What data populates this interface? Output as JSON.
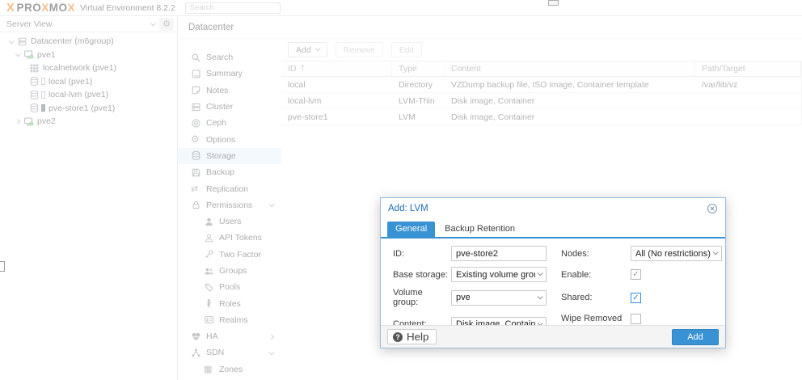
{
  "topbar": {
    "logo_mark": "X",
    "logo_parts": {
      "p1": "PRO",
      "x1": "X",
      "p2": "MO",
      "x2": "X"
    },
    "subtitle": "Virtual Environment 8.2.2",
    "search_placeholder": "Search"
  },
  "left_panel": {
    "view_selector": "Server View",
    "tree": [
      {
        "label": "Datacenter (m6group)",
        "icon": "datacenter"
      },
      {
        "label": "pve1",
        "icon": "node-online"
      },
      {
        "label": "localnetwork (pve1)",
        "icon": "network"
      },
      {
        "label": "local (pve1)",
        "icon": "storage"
      },
      {
        "label": "local-lvm (pve1)",
        "icon": "storage"
      },
      {
        "label": "pve-store1 (pve1)",
        "icon": "storage-active"
      },
      {
        "label": "pve2",
        "icon": "node-online"
      }
    ]
  },
  "panel": {
    "title": "Datacenter"
  },
  "menu": {
    "items": [
      {
        "label": "Search"
      },
      {
        "label": "Summary"
      },
      {
        "label": "Notes"
      },
      {
        "label": "Cluster"
      },
      {
        "label": "Ceph"
      },
      {
        "label": "Options"
      },
      {
        "label": "Storage",
        "selected": true
      },
      {
        "label": "Backup"
      },
      {
        "label": "Replication"
      },
      {
        "label": "Permissions",
        "expanded": true
      },
      {
        "label": "Users"
      },
      {
        "label": "API Tokens"
      },
      {
        "label": "Two Factor"
      },
      {
        "label": "Groups"
      },
      {
        "label": "Pools"
      },
      {
        "label": "Roles"
      },
      {
        "label": "Realms"
      },
      {
        "label": "HA",
        "expanded": false
      },
      {
        "label": "SDN",
        "expanded": true
      },
      {
        "label": "Zones"
      }
    ]
  },
  "main": {
    "toolbar": {
      "add": "Add",
      "remove": "Remove",
      "edit": "Edit"
    },
    "table": {
      "columns": [
        "ID",
        "Type",
        "Content",
        "Path/Target"
      ],
      "sorted_column": "ID",
      "rows": [
        [
          "local",
          "Directory",
          "VZDump backup file, ISO image, Container template",
          "/var/lib/vz"
        ],
        [
          "local-lvm",
          "LVM-Thin",
          "Disk image, Container",
          ""
        ],
        [
          "pve-store1",
          "LVM",
          "Disk image, Container",
          ""
        ]
      ]
    }
  },
  "dialog": {
    "title": "Add: LVM",
    "tabs": [
      "General",
      "Backup Retention"
    ],
    "active_tab": "General",
    "fields": {
      "id_label": "ID:",
      "id_value": "pve-store2",
      "base_label": "Base storage:",
      "base_value": "Existing volume groups",
      "vg_label": "Volume group:",
      "vg_value": "pve",
      "content_label": "Content:",
      "content_value": "Disk image, Container",
      "nodes_label": "Nodes:",
      "nodes_value": "All (No restrictions)",
      "enable_label": "Enable:",
      "enable_checked": true,
      "enable_disabled": true,
      "shared_label": "Shared:",
      "shared_checked": true,
      "wipe_label": "Wipe Removed Volumes:",
      "wipe_checked": false
    },
    "footer": {
      "help": "Help",
      "add": "Add"
    }
  },
  "colors": {
    "accent": "#3892d4",
    "logo_orange": "#e57000",
    "selected_menu_bg": "#e4f1fa",
    "dialog_title": "#1f6eb3"
  }
}
